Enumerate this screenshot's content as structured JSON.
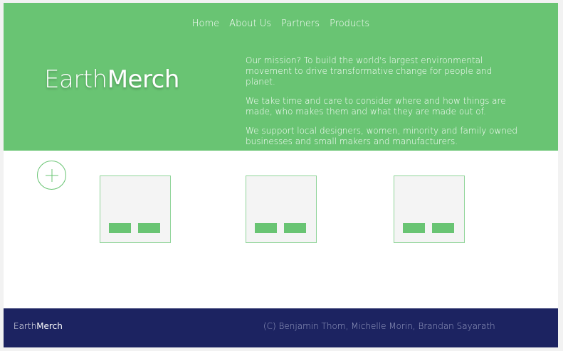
{
  "nav": {
    "items": [
      {
        "label": "Home"
      },
      {
        "label": "About Us"
      },
      {
        "label": "Partners"
      },
      {
        "label": "Products"
      }
    ]
  },
  "brand": {
    "light": "Earth",
    "bold": "Merch"
  },
  "mission": {
    "p1": "Our mission? To build the world's largest environmental movement to drive transformative change for people and planet.",
    "p2": "We take time and care to consider where and how things are made, who makes them and what they are made out of.",
    "p3": "We support local designers, women, minority and family owned businesses and small makers and manufacturers."
  },
  "footer": {
    "brand_light": "Earth",
    "brand_bold": "Merch",
    "copyright": "(C) Benjamin Thom, Michelle Morin, Brandan Sayarath"
  },
  "colors": {
    "accent": "#69c473",
    "footer_bg": "#1c2361",
    "card_bg": "#f4f4f4"
  },
  "icons": {
    "add": "plus-icon"
  }
}
